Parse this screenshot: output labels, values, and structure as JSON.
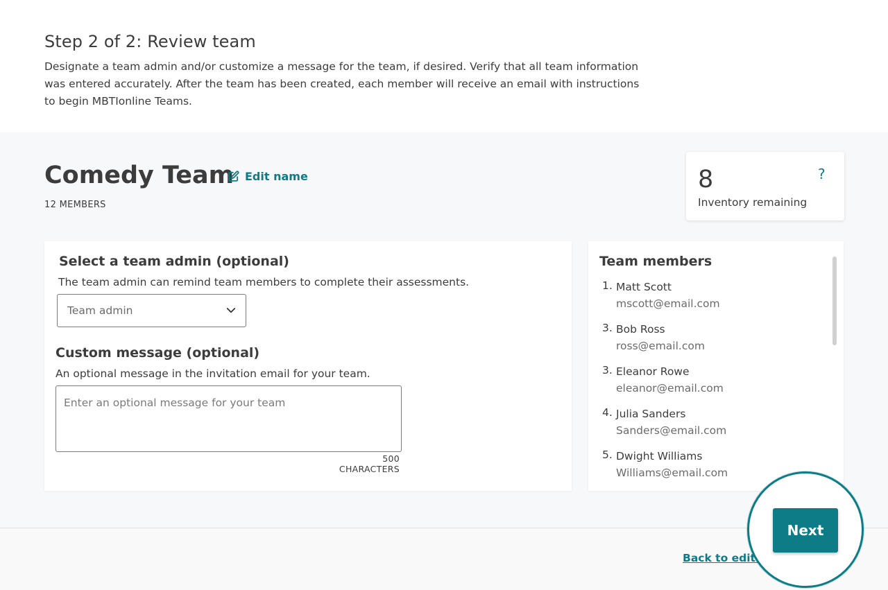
{
  "header": {
    "step_title": "Step 2 of 2: Review team",
    "description": "Designate a team admin and/or customize a message for the team, if desired. Verify that all team information was entered accurately. After the team has been created, each member will receive an email with instructions to begin MBTIonline Teams."
  },
  "team": {
    "name": "Comedy Team",
    "edit_label": "Edit name",
    "edit_icon": "edit-icon",
    "members_count": "12 MEMBERS"
  },
  "inventory": {
    "count": "8",
    "label": "Inventory remaining",
    "help": "?"
  },
  "admin": {
    "heading": "Select a team admin (optional)",
    "help": "The team admin can remind team members to complete their assessments.",
    "select_value": "Team admin",
    "chevron_icon": "chevron-down-icon"
  },
  "message": {
    "heading": "Custom message (optional)",
    "help": "An optional message in the invitation email for your team.",
    "placeholder": "Enter an optional message for your team",
    "char_limit": "500 CHARACTERS"
  },
  "members": {
    "heading": "Team members",
    "items": [
      {
        "num": "1.",
        "name": "Matt Scott",
        "email": "mscott@email.com"
      },
      {
        "num": "3.",
        "name": "Bob Ross",
        "email": "ross@email.com"
      },
      {
        "num": "3.",
        "name": "Eleanor Rowe",
        "email": "eleanor@email.com"
      },
      {
        "num": "4.",
        "name": "Julia Sanders",
        "email": "Sanders@email.com"
      },
      {
        "num": "5.",
        "name": "Dwight Williams",
        "email": "Williams@email.com"
      }
    ]
  },
  "footer": {
    "back_label": "Back to edit te",
    "next_label": "Next"
  },
  "colors": {
    "accent": "#0e7c86",
    "background": "#f7f8fa"
  }
}
